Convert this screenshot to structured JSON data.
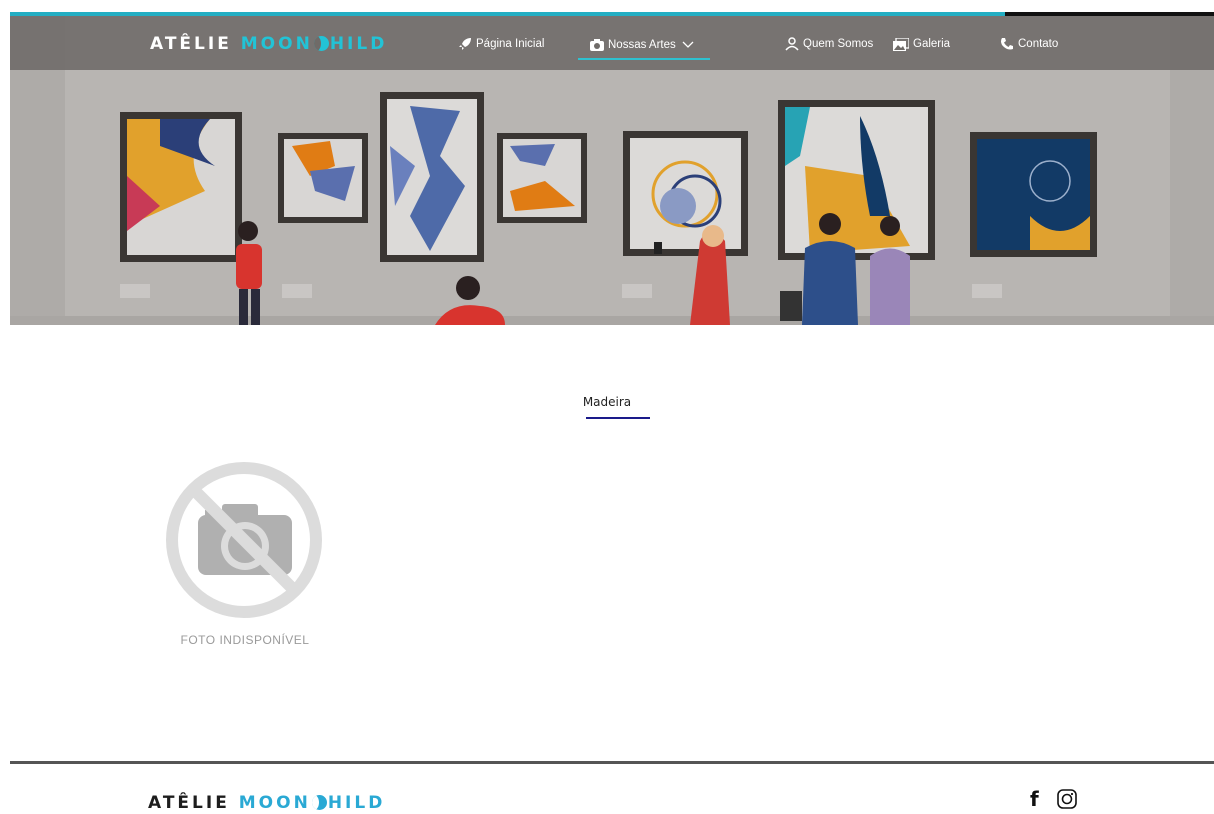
{
  "progress": {
    "fraction": 0.826,
    "track_color": "#111111",
    "fill_color": "#23aec3"
  },
  "brand": {
    "word1": "ATÊLIE",
    "word2a": "MOON",
    "word2b": "HILD",
    "accent": "#22c3d6"
  },
  "nav": {
    "items": [
      {
        "label": "Página Inicial",
        "icon": "rocket-icon"
      },
      {
        "label": "Nossas Artes",
        "icon": "camera-icon",
        "has_dropdown": true,
        "active": true
      },
      {
        "label": "Quem Somos",
        "icon": "people-icon"
      },
      {
        "label": "Galeria",
        "icon": "gallery-icon"
      },
      {
        "label": "Contato",
        "icon": "phone-icon"
      }
    ],
    "active_color": "#2ec1cf"
  },
  "hero": {
    "background": "#b7b4b1",
    "image": "gallery-illustration"
  },
  "main": {
    "section_title": "Madeira",
    "photo_caption": "FOTO INDISPONÍVEL",
    "photo_icon": "no-camera-icon"
  },
  "footer": {
    "social": [
      {
        "label": "f",
        "icon": "facebook-icon"
      },
      {
        "icon": "instagram-icon"
      }
    ]
  }
}
